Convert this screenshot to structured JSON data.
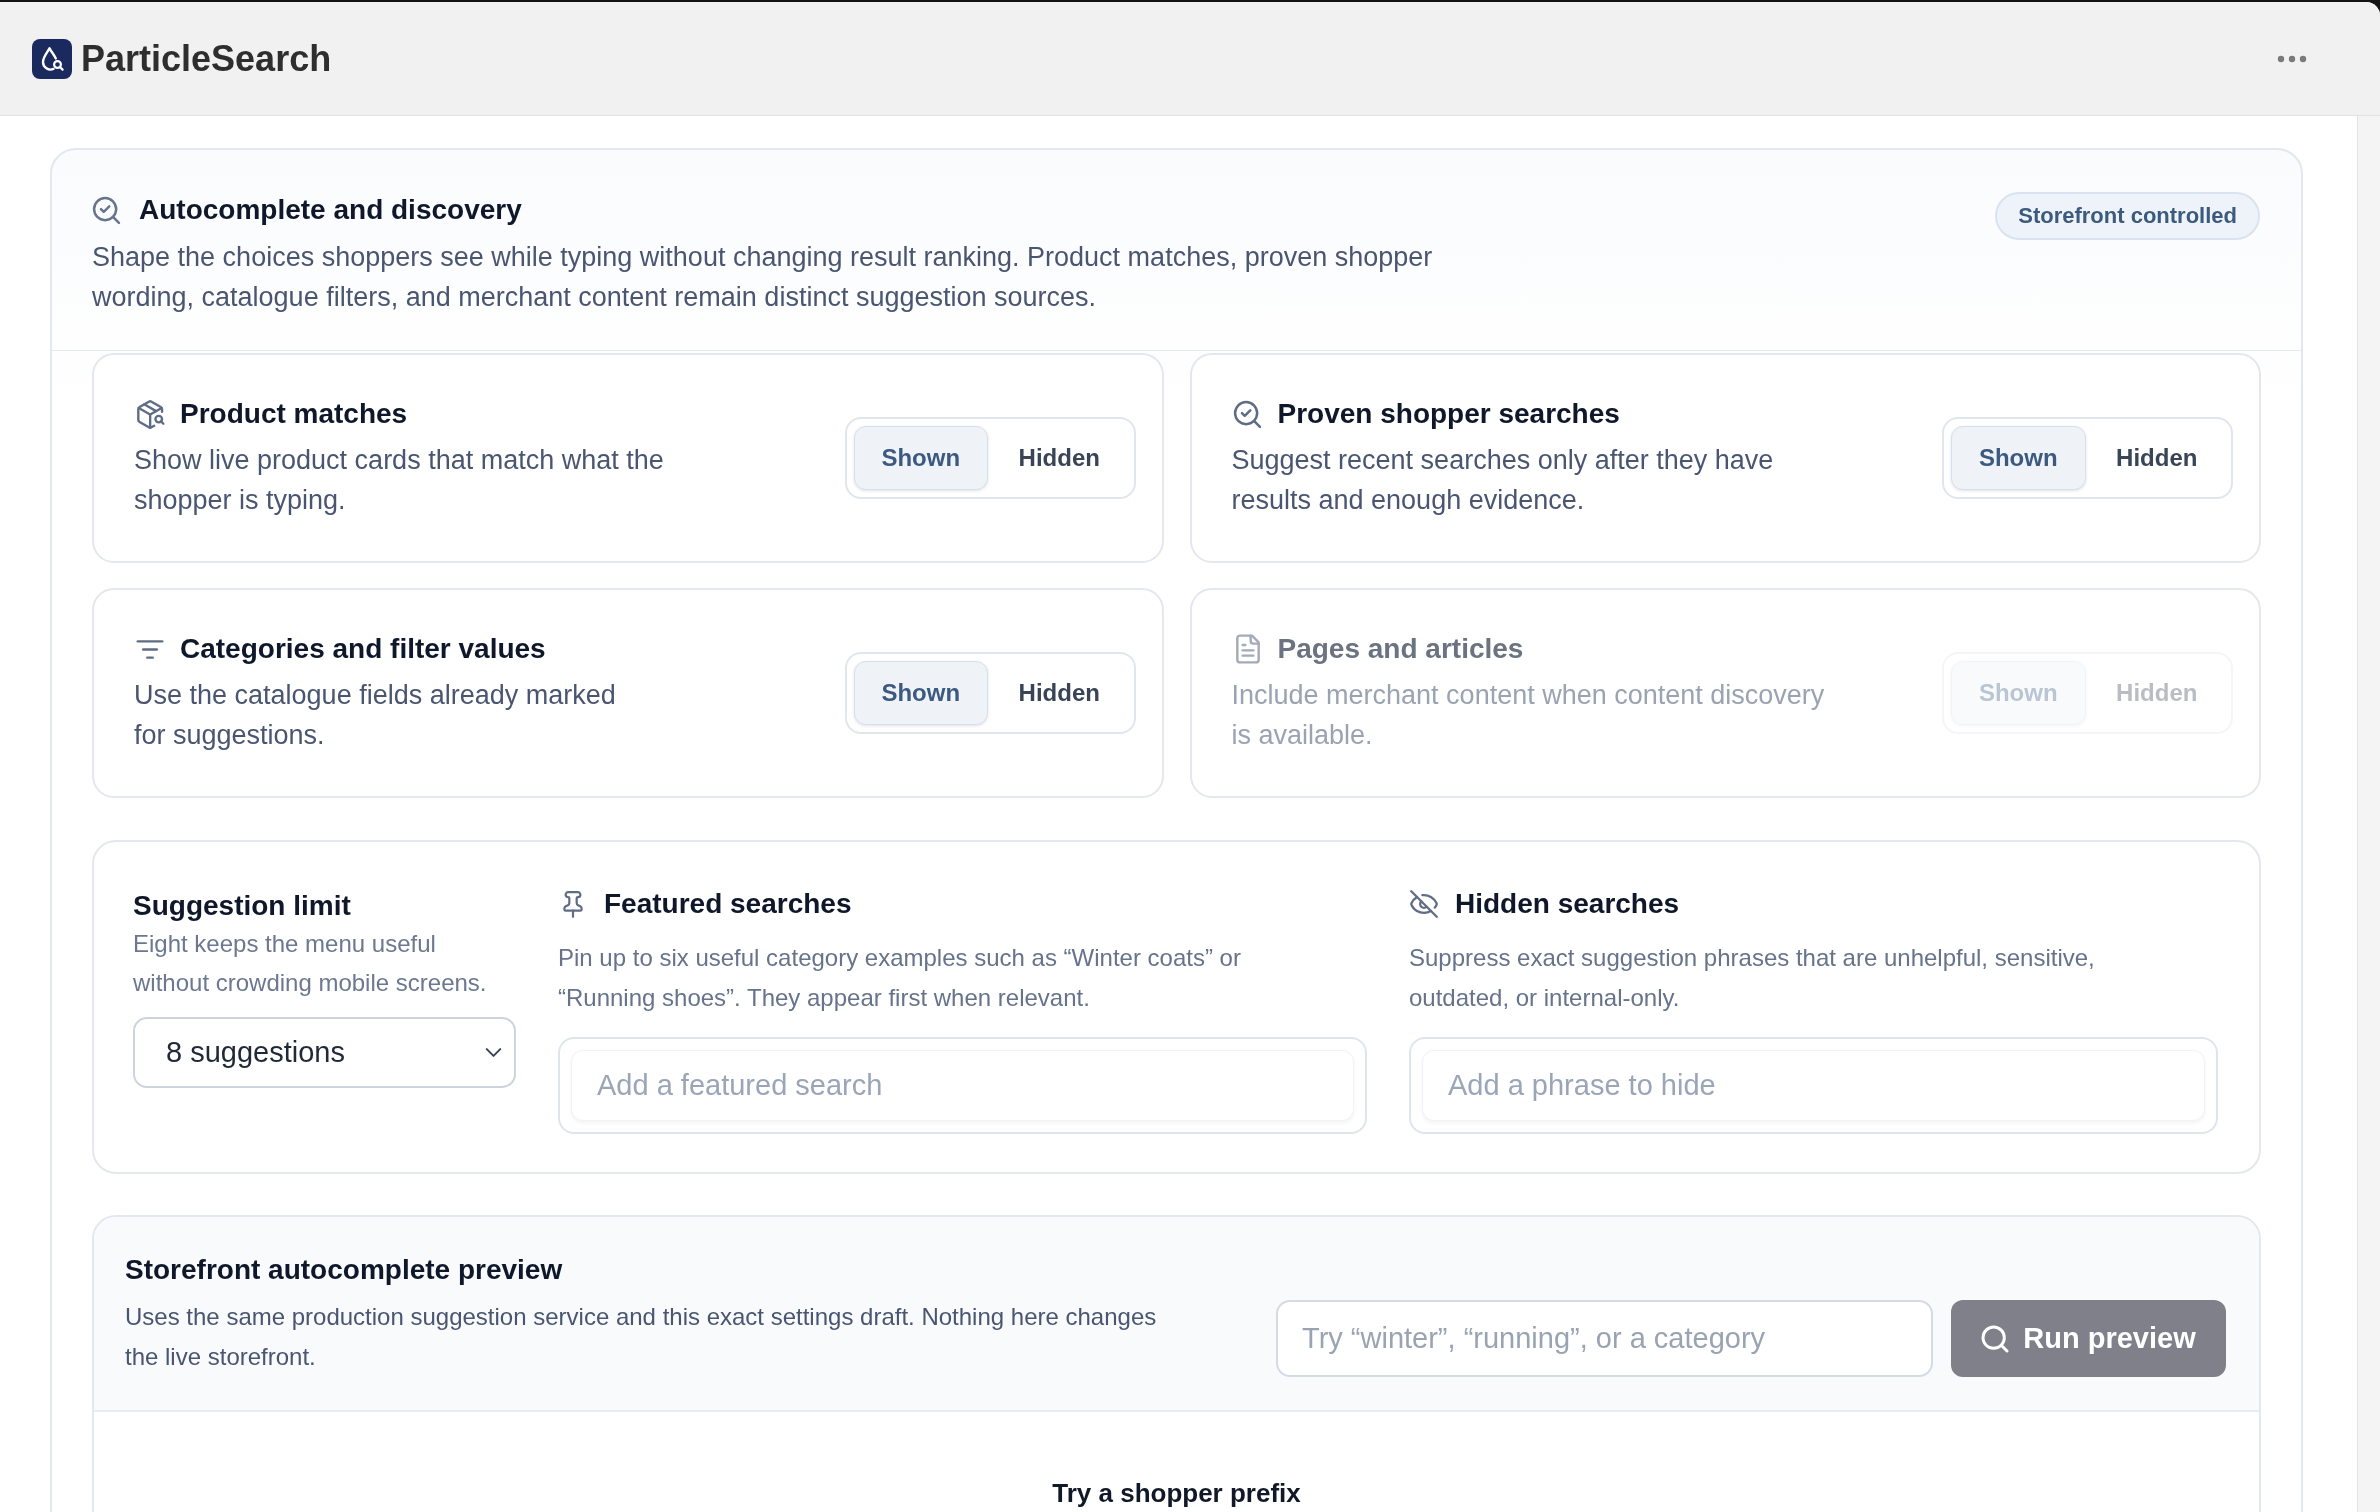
{
  "app": {
    "name": "ParticleSearch"
  },
  "section": {
    "title": "Autocomplete and discovery",
    "description": "Shape the choices shoppers see while typing without changing result ranking. Product matches, proven shopper wording, catalogue filters, and merchant content remain distinct suggestion sources.",
    "badge": "Storefront controlled"
  },
  "sources": [
    {
      "kind": "products",
      "title": "Product matches",
      "description": "Show live product cards that match what the shopper is typing.",
      "disabled": false,
      "options": [
        {
          "label": "Shown",
          "selected": true
        },
        {
          "label": "Hidden",
          "selected": false
        }
      ]
    },
    {
      "kind": "searches",
      "title": "Proven shopper searches",
      "description": "Suggest recent searches only after they have results and enough evidence.",
      "disabled": false,
      "options": [
        {
          "label": "Shown",
          "selected": true
        },
        {
          "label": "Hidden",
          "selected": false
        }
      ]
    },
    {
      "kind": "categories",
      "title": "Categories and filter values",
      "description": "Use the catalogue fields already marked for suggestions.",
      "disabled": false,
      "options": [
        {
          "label": "Shown",
          "selected": true
        },
        {
          "label": "Hidden",
          "selected": false
        }
      ]
    },
    {
      "kind": "pages",
      "title": "Pages and articles",
      "description": "Include merchant content when content discovery is available.",
      "disabled": true,
      "options": [
        {
          "label": "Shown",
          "selected": true
        },
        {
          "label": "Hidden",
          "selected": false
        }
      ]
    }
  ],
  "suggestion_limit": {
    "title": "Suggestion limit",
    "description": "Eight keeps the menu useful without crowding mobile screens.",
    "value": "8 suggestions"
  },
  "featured_searches": {
    "title": "Featured searches",
    "description": "Pin up to six useful category examples such as “Winter coats” or “Running shoes”. They appear first when relevant.",
    "placeholder": "Add a featured search"
  },
  "hidden_searches": {
    "title": "Hidden searches",
    "description": "Suppress exact suggestion phrases that are unhelpful, sensitive, outdated, or internal-only.",
    "placeholder": "Add a phrase to hide"
  },
  "preview": {
    "title": "Storefront autocomplete preview",
    "description": "Uses the same production suggestion service and this exact settings draft. Nothing here changes the live storefront.",
    "placeholder": "Try “winter”, “running”, or a category",
    "button": "Run preview",
    "empty_state": "Try a shopper prefix"
  }
}
